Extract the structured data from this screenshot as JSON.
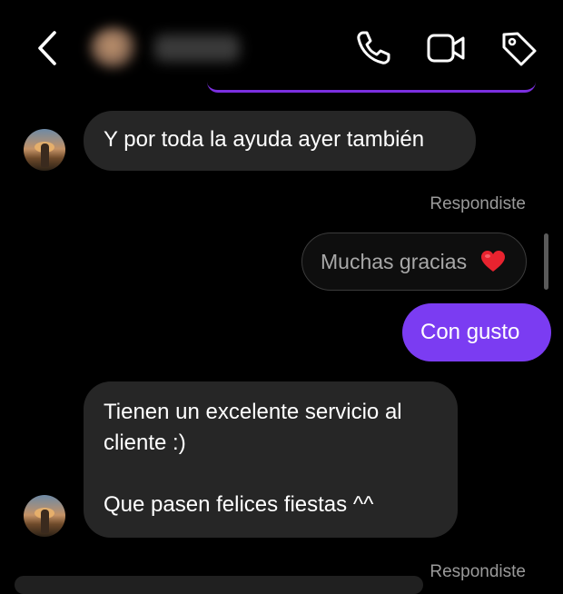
{
  "header": {
    "contact_name": "",
    "icons": {
      "back": "chevron-left-icon",
      "call": "phone-icon",
      "video": "video-camera-icon",
      "tag": "tag-icon"
    }
  },
  "messages": [
    {
      "type": "incoming",
      "text": "Y por toda la ayuda ayer también"
    },
    {
      "type": "reply_label",
      "text": "Respondiste"
    },
    {
      "type": "quoted_reply",
      "text": "Muchas gracias"
    },
    {
      "type": "outgoing",
      "text": "Con gusto"
    },
    {
      "type": "incoming",
      "lines": [
        "Tienen un excelente servicio al",
        "cliente :)",
        "",
        "Que pasen felices fiestas ^^"
      ]
    },
    {
      "type": "reply_label",
      "text": "Respondiste"
    }
  ],
  "colors": {
    "background": "#000000",
    "incoming_bubble": "#262626",
    "outgoing_bubble": "#7b3cf2",
    "quoted_text": "#a8a8a8",
    "label_text": "#9a9a9a",
    "heart": "#e8232f"
  }
}
